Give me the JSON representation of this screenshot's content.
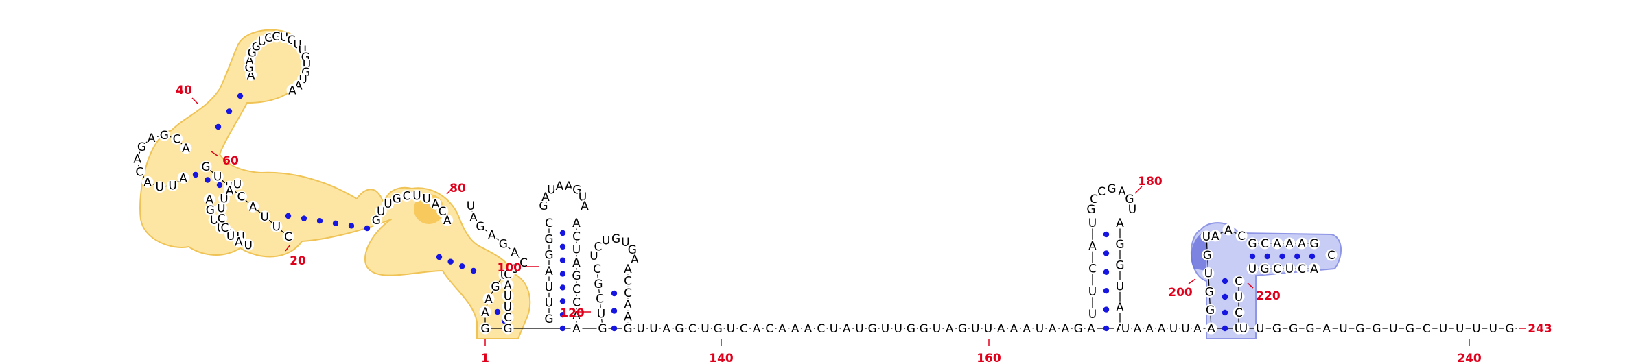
{
  "colors": {
    "highlight_yellow": "#fde6a3",
    "highlight_yellow_edge": "#efc355",
    "highlight_yellow_strong": "#f6c24a",
    "highlight_blue": "#c7cdf5",
    "highlight_blue_edge": "#8f96e6",
    "highlight_blue_strong": "#6e76dd",
    "pair_dot": "#1616e0",
    "number_red": "#e0001b",
    "backbone": "#000000"
  },
  "position_labels": [
    "1",
    "20",
    "40",
    "60",
    "80",
    "100",
    "120",
    "140",
    "160",
    "180",
    "200",
    "220",
    "240",
    "243"
  ],
  "segments": {
    "domain1_5p_stem": [
      "G",
      "A",
      "A",
      "G",
      "U",
      "C",
      "C",
      "A",
      "G",
      "A",
      "G",
      "A",
      "U"
    ],
    "domain1_lower_5p": [
      "U",
      "A",
      "U",
      "U",
      "G",
      "A"
    ],
    "domain1_3p_left": [
      "C",
      "U",
      "U",
      "A",
      "C",
      "U",
      "U",
      "G"
    ],
    "domain1_bottom_3p": [
      "G",
      "C",
      "U",
      "U",
      "A",
      "C"
    ],
    "domain2_top_loop": [
      "A",
      "G",
      "A",
      "G",
      "G",
      "U",
      "G",
      "G",
      "U",
      "C",
      "U",
      "U",
      "G",
      "U",
      "G",
      "U",
      "A",
      "A"
    ],
    "domain2_left_loop": [
      "A",
      "U",
      "U",
      "A",
      "C",
      "A",
      "G",
      "A",
      "G",
      "C",
      "A"
    ],
    "middle_loop": [
      "U",
      "A",
      "U",
      "C",
      "C",
      "U",
      "U",
      "A",
      "U"
    ],
    "right_small_loop": [
      "G",
      "U",
      "U",
      "G",
      "C",
      "U",
      "U",
      "A",
      "C",
      "A"
    ],
    "hairpin_a_5p": [
      "G",
      "U",
      "U",
      "A",
      "G",
      "G",
      "C"
    ],
    "hairpin_a_loop": [
      "G",
      "A",
      "U",
      "A",
      "A",
      "G",
      "U",
      "A"
    ],
    "hairpin_a_3p": [
      "A",
      "C",
      "U",
      "A",
      "G",
      "C",
      "C",
      "A",
      "A"
    ],
    "hairpin_b_5p": [
      "G",
      "U",
      "C",
      "G",
      "C"
    ],
    "hairpin_b_loop": [
      "U",
      "C",
      "U",
      "G",
      "U",
      "G",
      "A"
    ],
    "hairpin_b_3p": [
      "A",
      "C",
      "C",
      "A",
      "A",
      "C"
    ],
    "linker_1": [
      "G",
      "U",
      "U",
      "A",
      "G",
      "C",
      "U",
      "G",
      "U",
      "C",
      "A",
      "C",
      "A",
      "A",
      "A",
      "C",
      "U",
      "A",
      "U",
      "G",
      "U",
      "U",
      "G",
      "G",
      "U",
      "A",
      "G",
      "U",
      "U",
      "A",
      "A",
      "A",
      "U",
      "A",
      "A",
      "G",
      "A"
    ],
    "hairpin_c_5p": [
      "U",
      "U",
      "C",
      "A",
      "U"
    ],
    "hairpin_c_loop": [
      "G",
      "C",
      "C",
      "G",
      "A",
      "G",
      "U"
    ],
    "hairpin_c_3p": [
      "A",
      "G",
      "G",
      "U",
      "A",
      "A"
    ],
    "linker_2": [
      "U",
      "A",
      "A",
      "A",
      "U",
      "U",
      "A"
    ],
    "hairpin_d_5p": [
      "A",
      "G",
      "G",
      "U",
      "G",
      "U"
    ],
    "hairpin_d_loop": [
      "A",
      "A",
      "C"
    ],
    "hairpin_d_upper_5p": [
      "G",
      "C",
      "A",
      "A",
      "A",
      "G"
    ],
    "hairpin_d_upper_loop": [
      "C"
    ],
    "hairpin_d_upper_3p": [
      "A",
      "C",
      "U",
      "C",
      "G",
      "U"
    ],
    "hairpin_d_3p": [
      "C",
      "U",
      "C",
      "U"
    ],
    "tail_3p": [
      "U",
      "U",
      "G",
      "G",
      "G",
      "A",
      "U",
      "G",
      "G",
      "U",
      "G",
      "C",
      "U",
      "U",
      "U",
      "U",
      "G"
    ]
  }
}
